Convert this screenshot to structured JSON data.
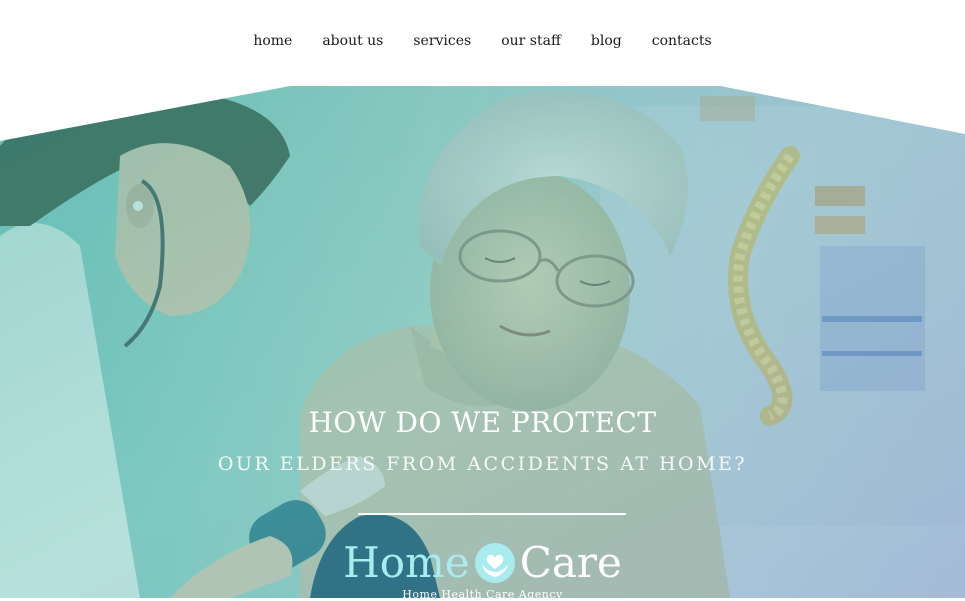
{
  "nav": {
    "items": [
      {
        "label": "home"
      },
      {
        "label": "about us"
      },
      {
        "label": "services"
      },
      {
        "label": "our staff"
      },
      {
        "label": "blog"
      },
      {
        "label": "contacts"
      }
    ]
  },
  "hero": {
    "headline_1": "HOW DO WE PROTECT",
    "headline_2": "OUR ELDERS FROM ACCIDENTS AT HOME?",
    "overlay_color": "#5fb9b4",
    "accent_color": "#a8ecef"
  },
  "logo": {
    "word_1": "Home",
    "word_2": "Care",
    "icon": "hands-heart-icon",
    "tagline": "Home Health Care Agency"
  }
}
